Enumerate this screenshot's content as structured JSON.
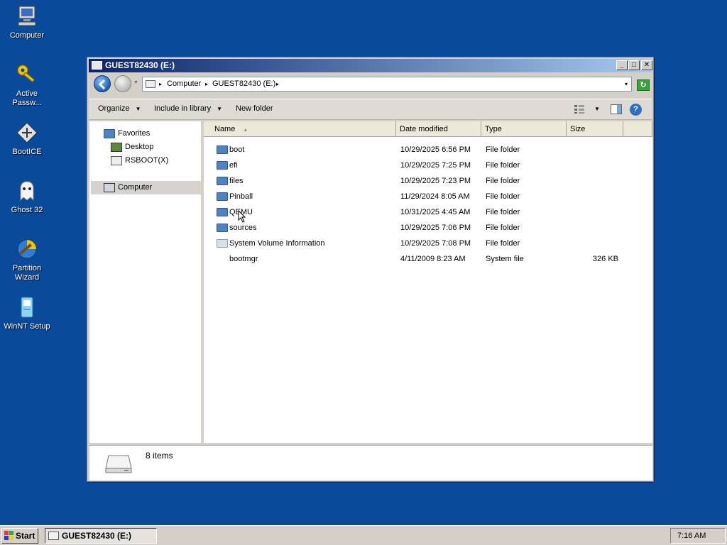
{
  "desktop": {
    "icons": [
      {
        "label": "Computer",
        "icon": "computer-icon"
      },
      {
        "label": "Active Passw...",
        "icon": "key-icon"
      },
      {
        "label": "BootICE",
        "icon": "bootice-icon"
      },
      {
        "label": "Ghost 32",
        "icon": "ghost-icon"
      },
      {
        "label": "Partition Wizard",
        "icon": "partition-wizard-icon"
      },
      {
        "label": "WinNT Setup",
        "icon": "winnt-setup-icon"
      }
    ]
  },
  "window": {
    "title": "GUEST82430 (E:)",
    "minimize_label": "_",
    "maximize_label": "□",
    "close_label": "✕"
  },
  "address": {
    "crumbs": [
      "Computer",
      "GUEST82430 (E:)"
    ],
    "separator": "▸",
    "dropdown": "▾"
  },
  "toolbar": {
    "organize": "Organize",
    "include_in_library": "Include in library",
    "new_folder": "New folder",
    "caret": "▼",
    "help": "?"
  },
  "navigation": {
    "favorites": "Favorites",
    "desktop": "Desktop",
    "rsboot": "RSBOOT(X)",
    "computer": "Computer"
  },
  "columns": {
    "name": "Name",
    "date_modified": "Date modified",
    "type": "Type",
    "size": "Size",
    "sort_indicator": "▲"
  },
  "files": [
    {
      "name": "boot",
      "date": "10/29/2025 6:56 PM",
      "type": "File folder",
      "size": "",
      "icon": "folder-icon"
    },
    {
      "name": "efi",
      "date": "10/29/2025 7:25 PM",
      "type": "File folder",
      "size": "",
      "icon": "folder-icon"
    },
    {
      "name": "files",
      "date": "10/29/2025 7:23 PM",
      "type": "File folder",
      "size": "",
      "icon": "folder-icon"
    },
    {
      "name": "Pinball",
      "date": "11/29/2024 8:05 AM",
      "type": "File folder",
      "size": "",
      "icon": "folder-icon"
    },
    {
      "name": "QEMU",
      "date": "10/31/2025 4:45 AM",
      "type": "File folder",
      "size": "",
      "icon": "folder-icon"
    },
    {
      "name": "sources",
      "date": "10/29/2025 7:06 PM",
      "type": "File folder",
      "size": "",
      "icon": "folder-icon"
    },
    {
      "name": "System Volume Information",
      "date": "10/29/2025 7:08 PM",
      "type": "File folder",
      "size": "",
      "icon": "system-folder-icon"
    },
    {
      "name": "bootmgr",
      "date": "4/11/2009 8:23 AM",
      "type": "System file",
      "size": "326 KB",
      "icon": "system-file-icon"
    }
  ],
  "details": {
    "item_count": "8 items"
  },
  "taskbar": {
    "start": "Start",
    "task_title": "GUEST82430 (E:)",
    "clock": "7:16 AM"
  },
  "colors": {
    "desktop_bg": "#0a4a9a",
    "titlebar_start": "#0a246a",
    "titlebar_end": "#a6caf0",
    "folder_blue": "#4e82c4"
  }
}
